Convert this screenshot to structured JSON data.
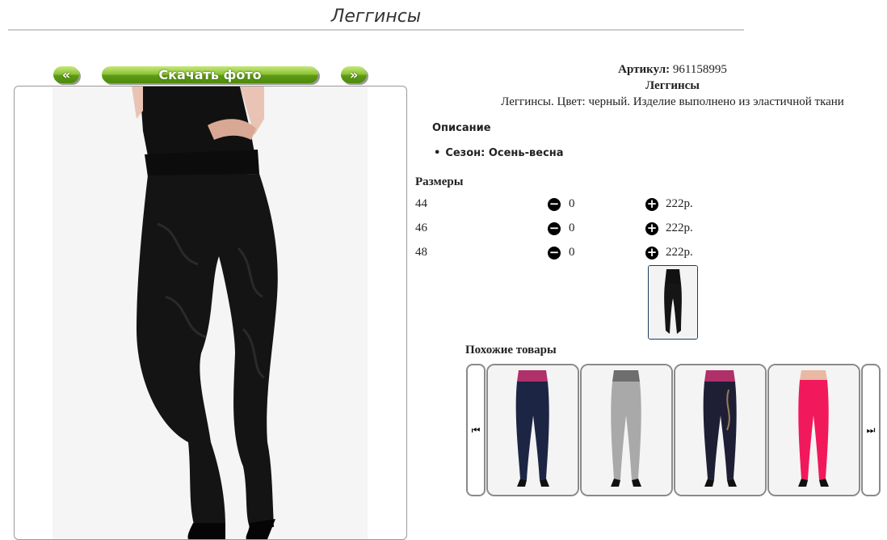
{
  "page_title": "Леггинсы",
  "gallery": {
    "prev_label": "«",
    "download_label": "Скачать фото",
    "next_label": "»"
  },
  "product": {
    "articul_label": "Артикул:",
    "articul_value": "961158995",
    "name": "Леггинсы",
    "description": "Леггинсы. Цвет: черный. Изделие выполнено из эластичной ткани"
  },
  "details": {
    "heading": "Описание",
    "season": "Сезон: Осень-весна"
  },
  "sizes": {
    "heading": "Размеры",
    "rows": [
      {
        "size": "44",
        "qty": "0",
        "price": "222р."
      },
      {
        "size": "46",
        "qty": "0",
        "price": "222р."
      },
      {
        "size": "48",
        "qty": "0",
        "price": "222р."
      }
    ]
  },
  "similar": {
    "heading": "Похожие товары",
    "items": [
      {
        "color": "navy",
        "hex": "#1c2544"
      },
      {
        "color": "gray",
        "hex": "#a9a9a9"
      },
      {
        "color": "navy-print",
        "hex": "#1e1f35"
      },
      {
        "color": "pink",
        "hex": "#f2185c"
      }
    ]
  },
  "icons": {
    "minus": "minus-circle-icon",
    "plus": "plus-circle-icon",
    "carousel_prev": "skip-back-icon",
    "carousel_next": "skip-forward-icon"
  }
}
